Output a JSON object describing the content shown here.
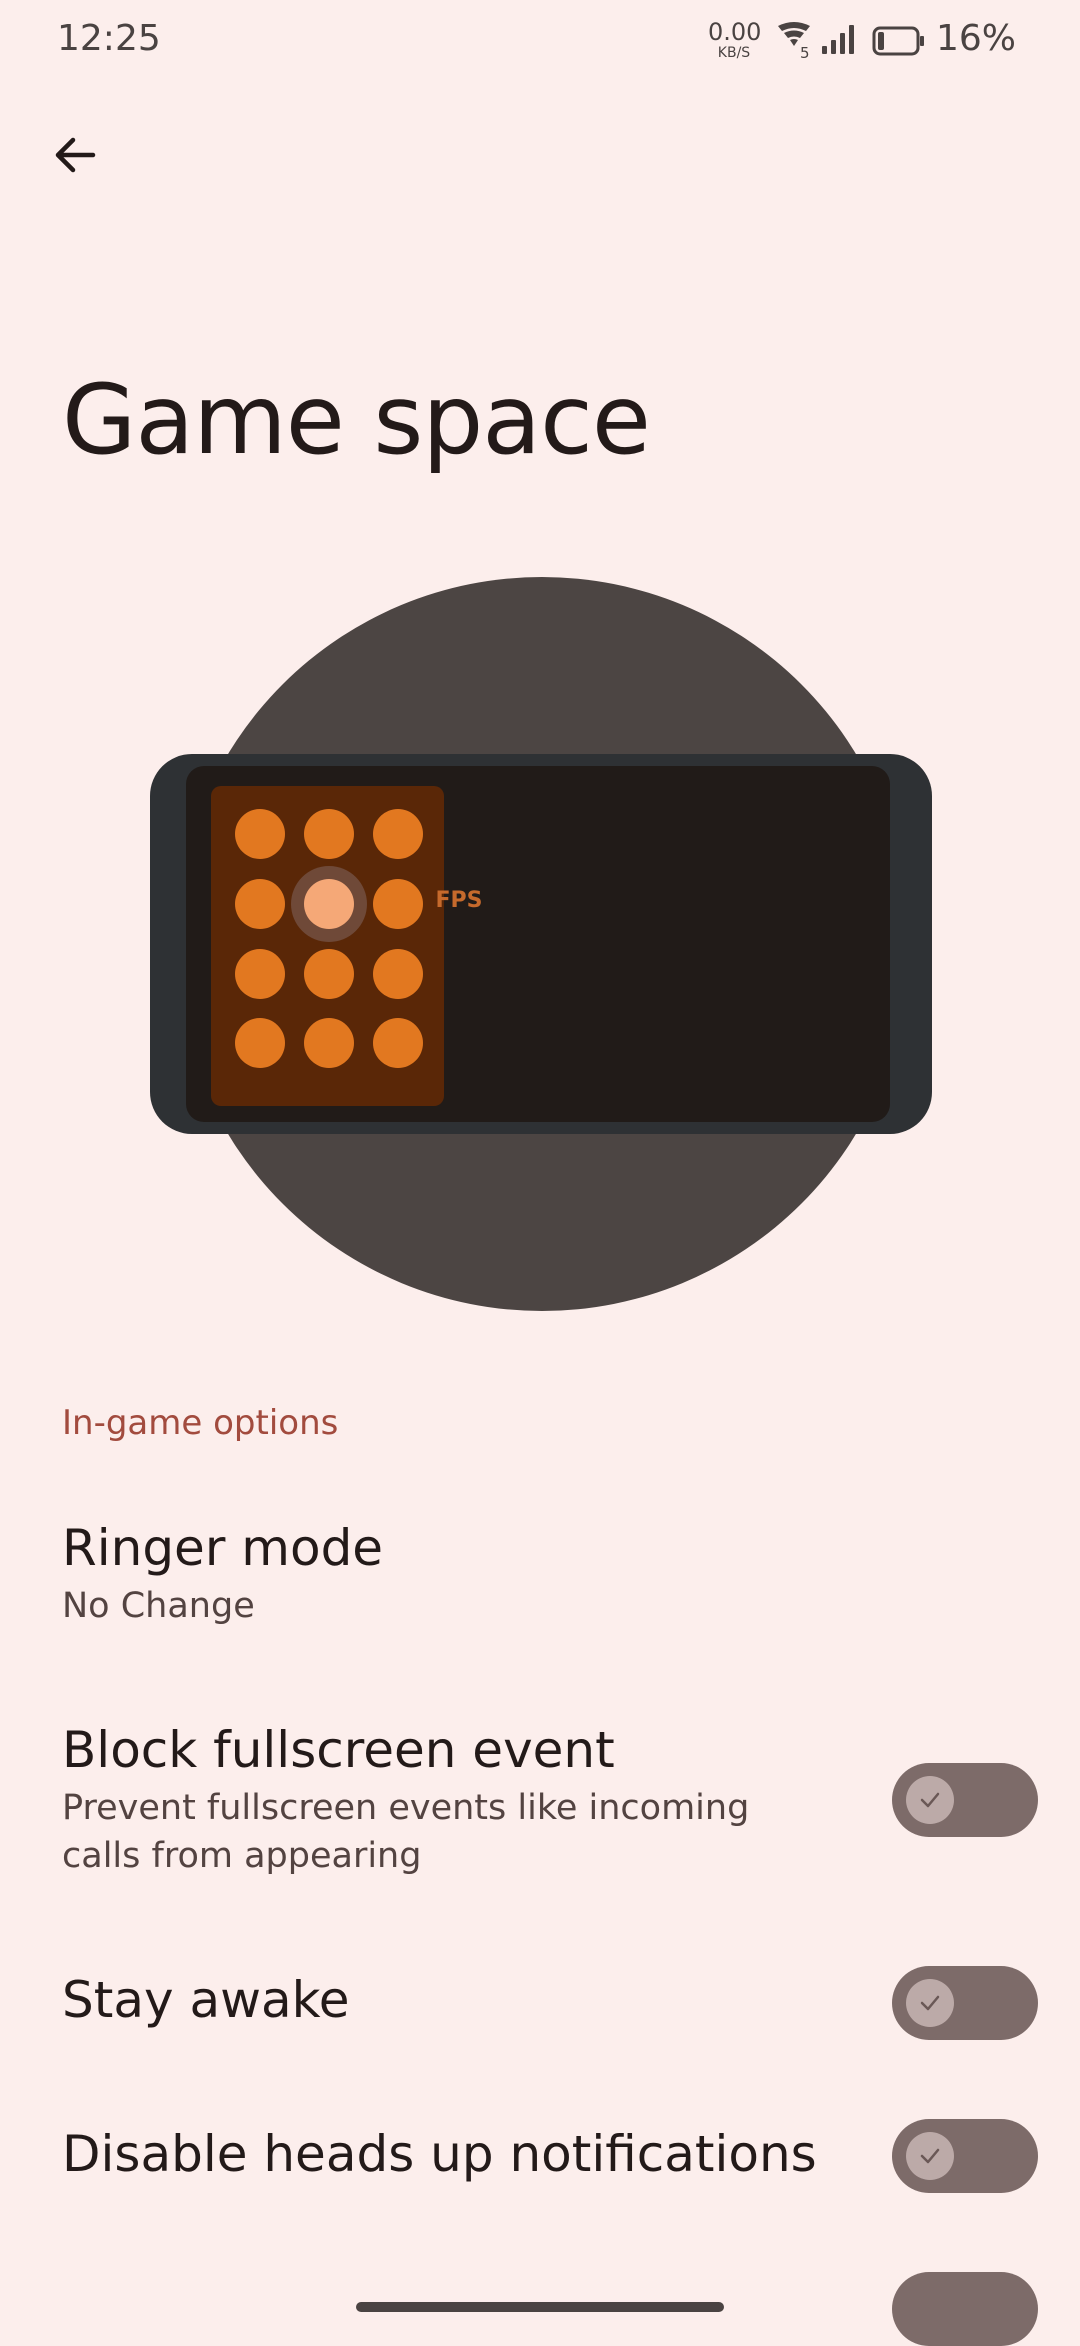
{
  "status_bar": {
    "time": "12:25",
    "net_speed_value": "0.00",
    "net_speed_unit": "KB/S",
    "wifi_badge": "5",
    "battery_percent": "16%",
    "icons": [
      "wifi-icon",
      "signal-icon",
      "battery-icon"
    ]
  },
  "header": {
    "back_icon": "arrow-left-icon",
    "title": "Game space"
  },
  "illustration": {
    "overlay_label": "FPS"
  },
  "section": {
    "title": "In-game options"
  },
  "preferences": [
    {
      "title": "Ringer mode",
      "summary": "No Change"
    },
    {
      "title": "Block fullscreen event",
      "summary": "Prevent fullscreen events like incoming calls from appearing",
      "switch": "off"
    },
    {
      "title": "Stay awake",
      "switch": "off"
    },
    {
      "title": "Disable heads up notifications",
      "switch": "off"
    }
  ],
  "colors": {
    "background": "#FCEEEC",
    "section_header": "#A24B3E",
    "switch_track": "#7D6B69",
    "switch_thumb": "#BCAAA8",
    "illustration_circle": "#4C4543",
    "illustration_orange": "#E27820"
  }
}
